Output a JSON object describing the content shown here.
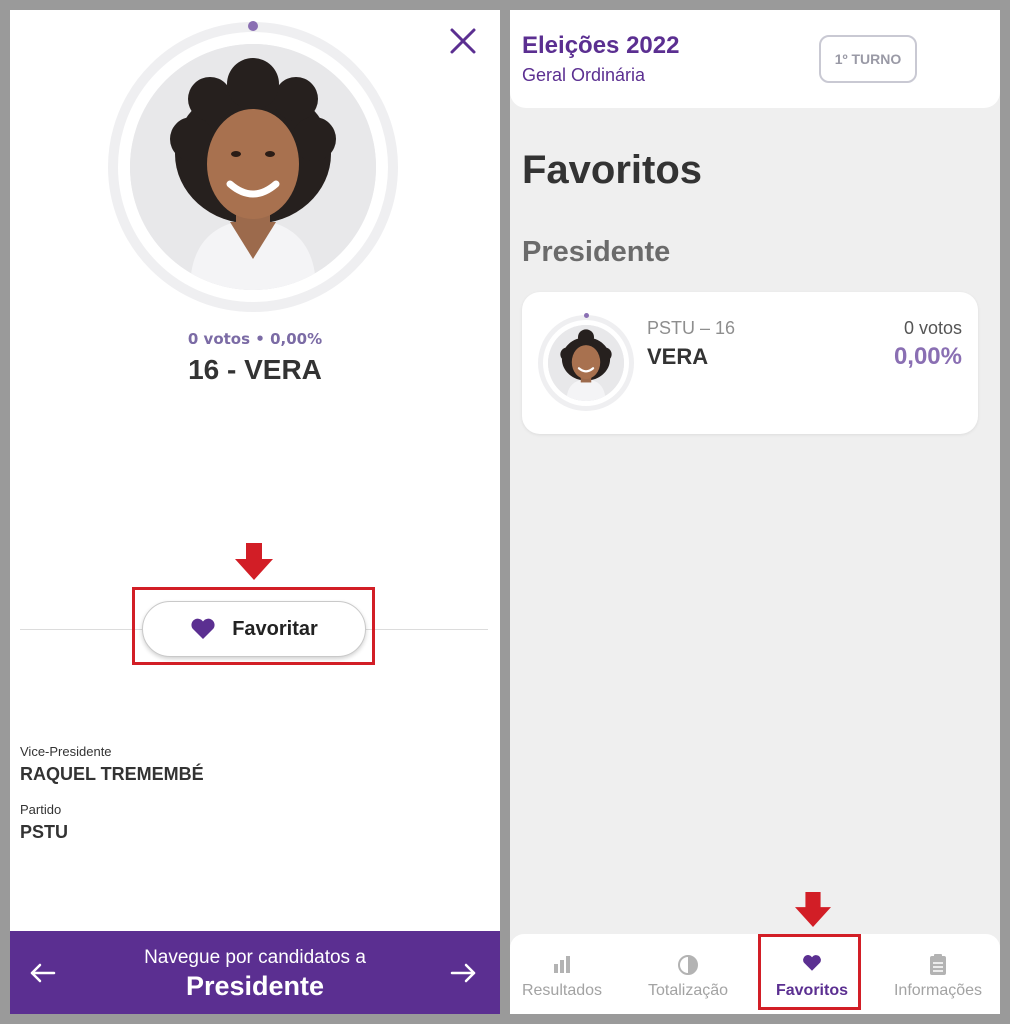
{
  "left": {
    "close_icon": "close-icon",
    "candidate_stats": "0 votos • 0,00%",
    "candidate_title": "16 - VERA",
    "favorite_button_label": "Favoritar",
    "vice_label": "Vice-Presidente",
    "vice_value": "RAQUEL TREMEMBÉ",
    "party_label": "Partido",
    "party_value": "PSTU",
    "nav_sub": "Navegue por candidatos a",
    "nav_main": "Presidente"
  },
  "right": {
    "header_title": "Eleições 2022",
    "header_subtitle": "Geral Ordinária",
    "turno_badge": "1º TURNO",
    "page_title": "Favoritos",
    "section_title": "Presidente",
    "card": {
      "party_number": "PSTU – 16",
      "name": "VERA",
      "votes": "0 votos",
      "percent": "0,00%"
    },
    "tabs": [
      {
        "label": "Resultados",
        "icon": "bar-chart-icon",
        "active": false
      },
      {
        "label": "Totalização",
        "icon": "pie-chart-icon",
        "active": false
      },
      {
        "label": "Favoritos",
        "icon": "heart-icon",
        "active": true
      },
      {
        "label": "Informações",
        "icon": "document-icon",
        "active": false
      }
    ]
  },
  "colors": {
    "brand_purple": "#5b2f91",
    "accent_lilac": "#8a6fb3",
    "annotation_red": "#d21e26"
  }
}
